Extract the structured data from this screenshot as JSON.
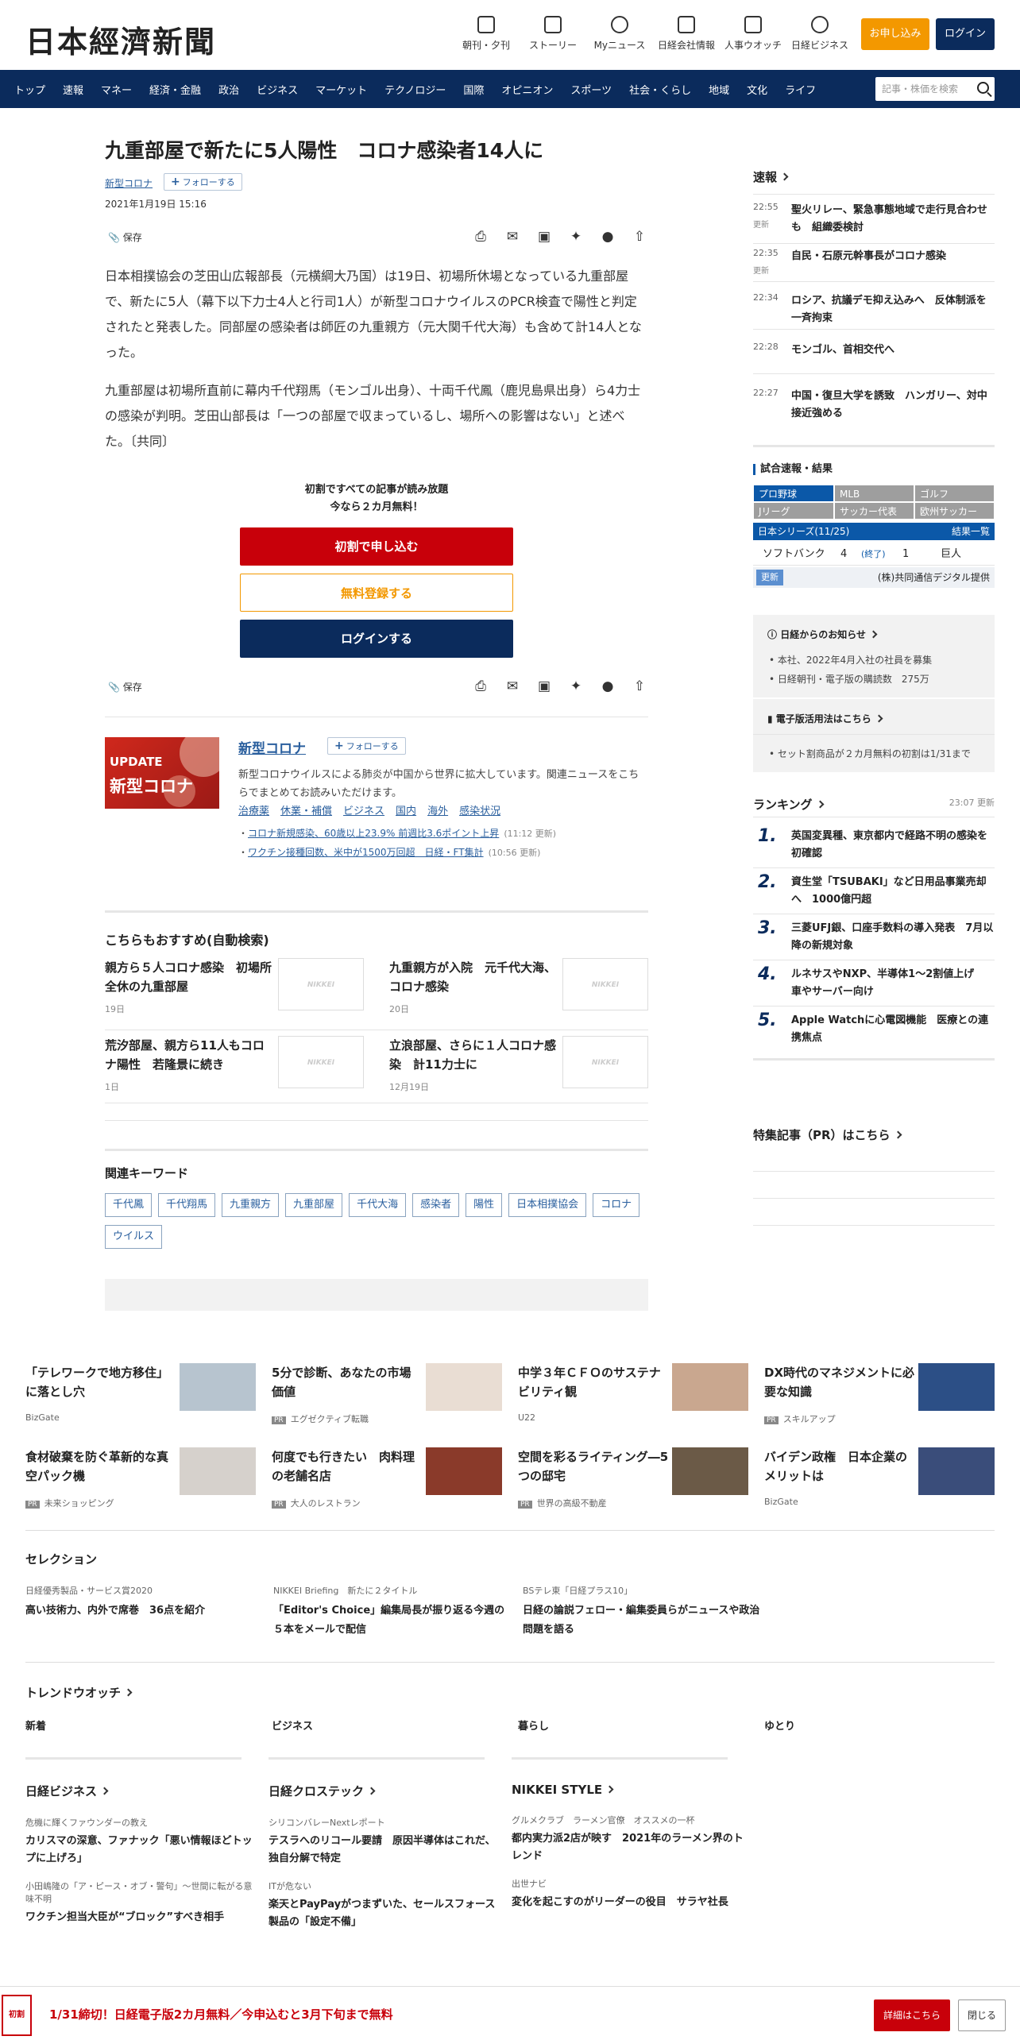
{
  "header": {
    "logo": "日本經濟新聞",
    "icons": [
      {
        "label": "朝刊・夕刊",
        "icon": "newspaper-icon"
      },
      {
        "label": "ストーリー",
        "icon": "story-icon"
      },
      {
        "label": "Myニュース",
        "icon": "user-icon"
      },
      {
        "label": "日経会社情報",
        "icon": "chart-icon"
      },
      {
        "label": "人事ウオッチ",
        "icon": "search-person-icon"
      },
      {
        "label": "日経ビジネス",
        "icon": "compass-icon"
      }
    ],
    "subscribe": "お申し込み",
    "login": "ログイン"
  },
  "nav": {
    "items": [
      "トップ",
      "速報",
      "マネー",
      "経済・金融",
      "政治",
      "ビジネス",
      "マーケット",
      "テクノロジー",
      "国際",
      "オピニオン",
      "スポーツ",
      "社会・くらし",
      "地域",
      "文化",
      "ライフ"
    ],
    "search_placeholder": "記事・株価を検索"
  },
  "article": {
    "title": "九重部屋で新たに5人陽性　コロナ感染者14人に",
    "topic": "新型コロナ",
    "follow": "フォローする",
    "date": "2021年1月19日 15:16",
    "save": "保存",
    "paragraphs": [
      "日本相撲協会の芝田山広報部長（元横綱大乃国）は19日、初場所休場となっている九重部屋で、新たに5人（幕下以下力士4人と行司1人）が新型コロナウイルスのPCR検査で陽性と判定されたと発表した。同部屋の感染者は師匠の九重親方（元大関千代大海）も含めて計14人となった。",
      "九重部屋は初場所直前に幕内千代翔馬（モンゴル出身）、十両千代鳳（鹿児島県出身）ら4力士の感染が判明。芝田山部長は「一つの部屋で収まっているし、場所への影響はない」と述べた。〔共同〕"
    ]
  },
  "paywall": {
    "line1": "初割ですべての記事が読み放題",
    "line2": "今なら２カ月無料！",
    "btn_trial": "初割で申し込む",
    "btn_free": "無料登録する",
    "btn_login": "ログインする"
  },
  "topic_box": {
    "img_line1": "UPDATE",
    "img_line2": "新型コロナ",
    "title": "新型コロナ",
    "follow": "フォローする",
    "desc": "新型コロナウイルスによる肺炎が中国から世界に拡大しています。関連ニュースをこちらでまとめてお読みいただけます。",
    "links": [
      "治療薬",
      "休業・補償",
      "ビジネス",
      "国内",
      "海外",
      "感染状況"
    ],
    "news": [
      {
        "text": "コロナ新規感染、60歳以上23.9% 前週比3.6ポイント上昇",
        "time": "(11:12 更新)"
      },
      {
        "text": "ワクチン接種回数、米中が1500万回超　日経・FT集計",
        "time": "(10:56 更新)"
      }
    ]
  },
  "recommend": {
    "heading": "こちらもおすすめ(自動検索)",
    "placeholder": "NIKKEI",
    "items": [
      {
        "title": "親方ら５人コロナ感染　初場所全休の九重部屋",
        "date": "19日"
      },
      {
        "title": "九重親方が入院　元千代大海、コロナ感染",
        "date": "20日"
      },
      {
        "title": "荒汐部屋、親方ら11人もコロナ陽性　若隆景に続き",
        "date": "1日"
      },
      {
        "title": "立浪部屋、さらに１人コロナ感染　計11力士に",
        "date": "12月19日"
      }
    ]
  },
  "keywords": {
    "heading": "関連キーワード",
    "items": [
      "千代鳳",
      "千代翔馬",
      "九重親方",
      "九重部屋",
      "千代大海",
      "感染者",
      "陽性",
      "日本相撲協会",
      "コロナ",
      "ウイルス"
    ]
  },
  "sidebar": {
    "flash_heading": "速報",
    "flash": [
      {
        "time": "22:55",
        "upd": "更新",
        "text": "聖火リレー、緊急事態地域で走行見合わせも　組織委検討"
      },
      {
        "time": "22:35",
        "upd": "更新",
        "text": "自民・石原元幹事長がコロナ感染"
      },
      {
        "time": "22:34",
        "upd": "",
        "text": "ロシア、抗議デモ抑え込みへ　反体制派を一斉拘束"
      },
      {
        "time": "22:28",
        "upd": "",
        "text": "モンゴル、首相交代へ"
      },
      {
        "time": "22:27",
        "upd": "",
        "text": "中国・復旦大学を誘致　ハンガリー、対中接近強める"
      }
    ],
    "score": {
      "heading": "試合速報・結果",
      "tabs": [
        "プロ野球",
        "MLB",
        "ゴルフ",
        "Jリーグ",
        "サッカー代表",
        "欧州サッカー"
      ],
      "series": "日本シリーズ(11/25)",
      "results_link": "結果一覧",
      "team1": "ソフトバンク",
      "score1": "4",
      "status": "(終了)",
      "score2": "1",
      "team2": "巨人",
      "update": "更新",
      "provider": "(株)共同通信デジタル提供"
    },
    "notice_heading": "日経からのお知らせ",
    "notices": [
      "本社、2022年4月入社の社員を募集",
      "日経朝刊・電子版の購読数　275万"
    ],
    "ebook_heading": "電子版活用法はこちら",
    "ebook_item": "セット割商品が２カ月無料の初割は1/31まで",
    "ranking_heading": "ランキング",
    "ranking_time": "23:07  更新",
    "ranking": [
      {
        "n": "1.",
        "text": "英国変異種、東京都内で経路不明の感染を初確認"
      },
      {
        "n": "2.",
        "text": "資生堂「TSUBAKI」など日用品事業売却へ　1000億円超"
      },
      {
        "n": "3.",
        "text": "三菱UFJ銀、口座手数料の導入発表　7月以降の新規対象"
      },
      {
        "n": "4.",
        "text": "ルネサスやNXP、半導体1～2割値上げ　車やサーバー向け"
      },
      {
        "n": "5.",
        "text": "Apple Watchに心電図機能　医療との連携焦点"
      }
    ],
    "pr_heading": "特集記事（PR）はこちら"
  },
  "pr_items": [
    {
      "title": "「テレワークで地方移住」に落とし穴",
      "source": "BizGate",
      "pr": false,
      "color": "#b7c4cf"
    },
    {
      "title": "5分で診断、あなたの市場価値",
      "source": "エグゼクティブ転職",
      "pr": true,
      "color": "#e9ddd3"
    },
    {
      "title": "中学３年ＣＦＯのサステナビリティ観",
      "source": "U22",
      "pr": false,
      "color": "#c9a78f"
    },
    {
      "title": "DX時代のマネジメントに必要な知識",
      "source": "スキルアップ",
      "pr": true,
      "color": "#2c4f86"
    },
    {
      "title": "食材破棄を防ぐ革新的な真空パック機",
      "source": "未来ショッピング",
      "pr": true,
      "color": "#d6d1cc"
    },
    {
      "title": "何度でも行きたい　肉料理の老舗名店",
      "source": "大人のレストラン",
      "pr": true,
      "color": "#8a3a2a"
    },
    {
      "title": "空間を彩るライティング―5つの邸宅",
      "source": "世界の高級不動産",
      "pr": true,
      "color": "#6b5a47"
    },
    {
      "title": "バイデン政権　日本企業のメリットは",
      "source": "BizGate",
      "pr": false,
      "color": "#3a4d7a"
    }
  ],
  "selection": {
    "heading": "セレクション",
    "items": [
      {
        "cat": "日経優秀製品・サービス賞2020",
        "text": "高い技術力、内外で席巻　36点を紹介"
      },
      {
        "cat": "NIKKEI Briefing　新たに２タイトル",
        "text": "「Editor's Choice」編集局長が振り返る今週の５本をメールで配信"
      },
      {
        "cat": "BSテレ東「日経プラス10」",
        "text": "日経の論説フェロー・編集委員らがニュースや政治問題を語る"
      }
    ]
  },
  "trend": {
    "heading": "トレンドウオッチ",
    "tabs": [
      "新着",
      "ビジネス",
      "暮らし",
      "ゆとり"
    ]
  },
  "publications": [
    {
      "name": "日経ビジネス",
      "items": [
        {
          "cat": "危機に輝くファウンダーの教え",
          "text": "カリスマの深意、ファナック「悪い情報ほどトップに上げろ」"
        },
        {
          "cat": "小田嶋隆の「ア・ピース・オブ・警句」～世間に転がる意味不明",
          "text": "ワクチン担当大臣が“ブロック”すべき相手"
        }
      ]
    },
    {
      "name": "日経クロステック",
      "items": [
        {
          "cat": "シリコンバレーNextレポート",
          "text": "テスラへのリコール要請　原因半導体はこれだ、独自分解で特定"
        },
        {
          "cat": "ITが危ない",
          "text": "楽天とPayPayがつまずいた、セールスフォース製品の「設定不備」"
        }
      ]
    },
    {
      "name": "NIKKEI STYLE",
      "items": [
        {
          "cat": "グルメクラブ　ラーメン官僚　オススメの一杯",
          "text": "都内実力派2店が映す　2021年のラーメン界のトレンド"
        },
        {
          "cat": "出世ナビ",
          "text": "変化を起こすのがリーダーの役目　サラヤ社長"
        }
      ]
    }
  ],
  "footer": {
    "badge": "初割",
    "text": "1/31締切！日経電子版2カ月無料／今申込むと3月下旬まで無料",
    "detail": "詳細はこちら",
    "close": "閉じる"
  }
}
